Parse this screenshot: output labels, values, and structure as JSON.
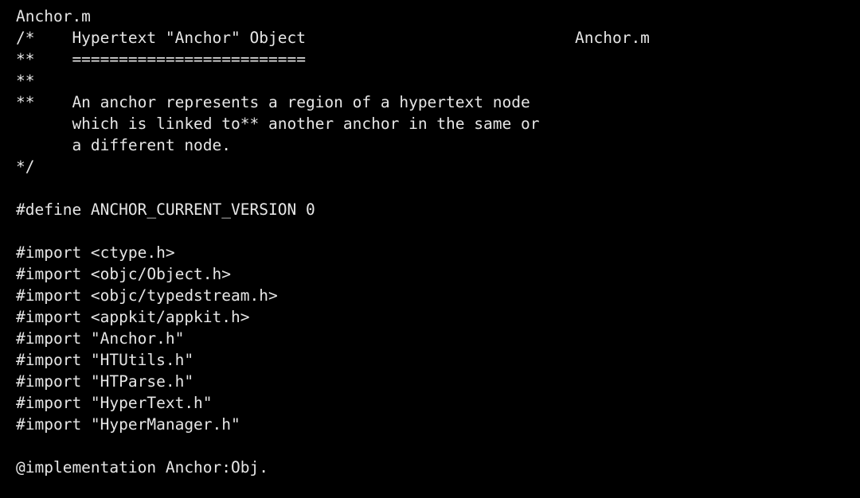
{
  "document": {
    "filename": "Anchor.m",
    "language": "objective-c",
    "background_color": "#000000",
    "text_color": "#e6e6e6",
    "header_right_label": "Anchor.m",
    "lines": [
      {
        "text": "Anchor.m",
        "kind": "title"
      },
      {
        "text": "/*    Hypertext \"Anchor\" Object",
        "kind": "comment",
        "right_label": "Anchor.m"
      },
      {
        "text": "**    =========================",
        "kind": "comment"
      },
      {
        "text": "**",
        "kind": "comment"
      },
      {
        "text": "**    An anchor represents a region of a hypertext node",
        "kind": "comment"
      },
      {
        "text": "      which is linked to** another anchor in the same or",
        "kind": "comment"
      },
      {
        "text": "      a different node.",
        "kind": "comment"
      },
      {
        "text": "*/",
        "kind": "comment"
      },
      {
        "text": "",
        "kind": "blank"
      },
      {
        "text": "#define ANCHOR_CURRENT_VERSION 0",
        "kind": "preprocessor"
      },
      {
        "text": "",
        "kind": "blank"
      },
      {
        "text": "#import <ctype.h>",
        "kind": "preprocessor"
      },
      {
        "text": "#import <objc/Object.h>",
        "kind": "preprocessor"
      },
      {
        "text": "#import <objc/typedstream.h>",
        "kind": "preprocessor"
      },
      {
        "text": "#import <appkit/appkit.h>",
        "kind": "preprocessor"
      },
      {
        "text": "#import \"Anchor.h\"",
        "kind": "preprocessor"
      },
      {
        "text": "#import \"HTUtils.h\"",
        "kind": "preprocessor"
      },
      {
        "text": "#import \"HTParse.h\"",
        "kind": "preprocessor"
      },
      {
        "text": "#import \"HyperText.h\"",
        "kind": "preprocessor"
      },
      {
        "text": "#import \"HyperManager.h\"",
        "kind": "preprocessor"
      },
      {
        "text": "",
        "kind": "blank"
      },
      {
        "text": "@implementation Anchor:Obj.",
        "kind": "declaration"
      }
    ]
  }
}
